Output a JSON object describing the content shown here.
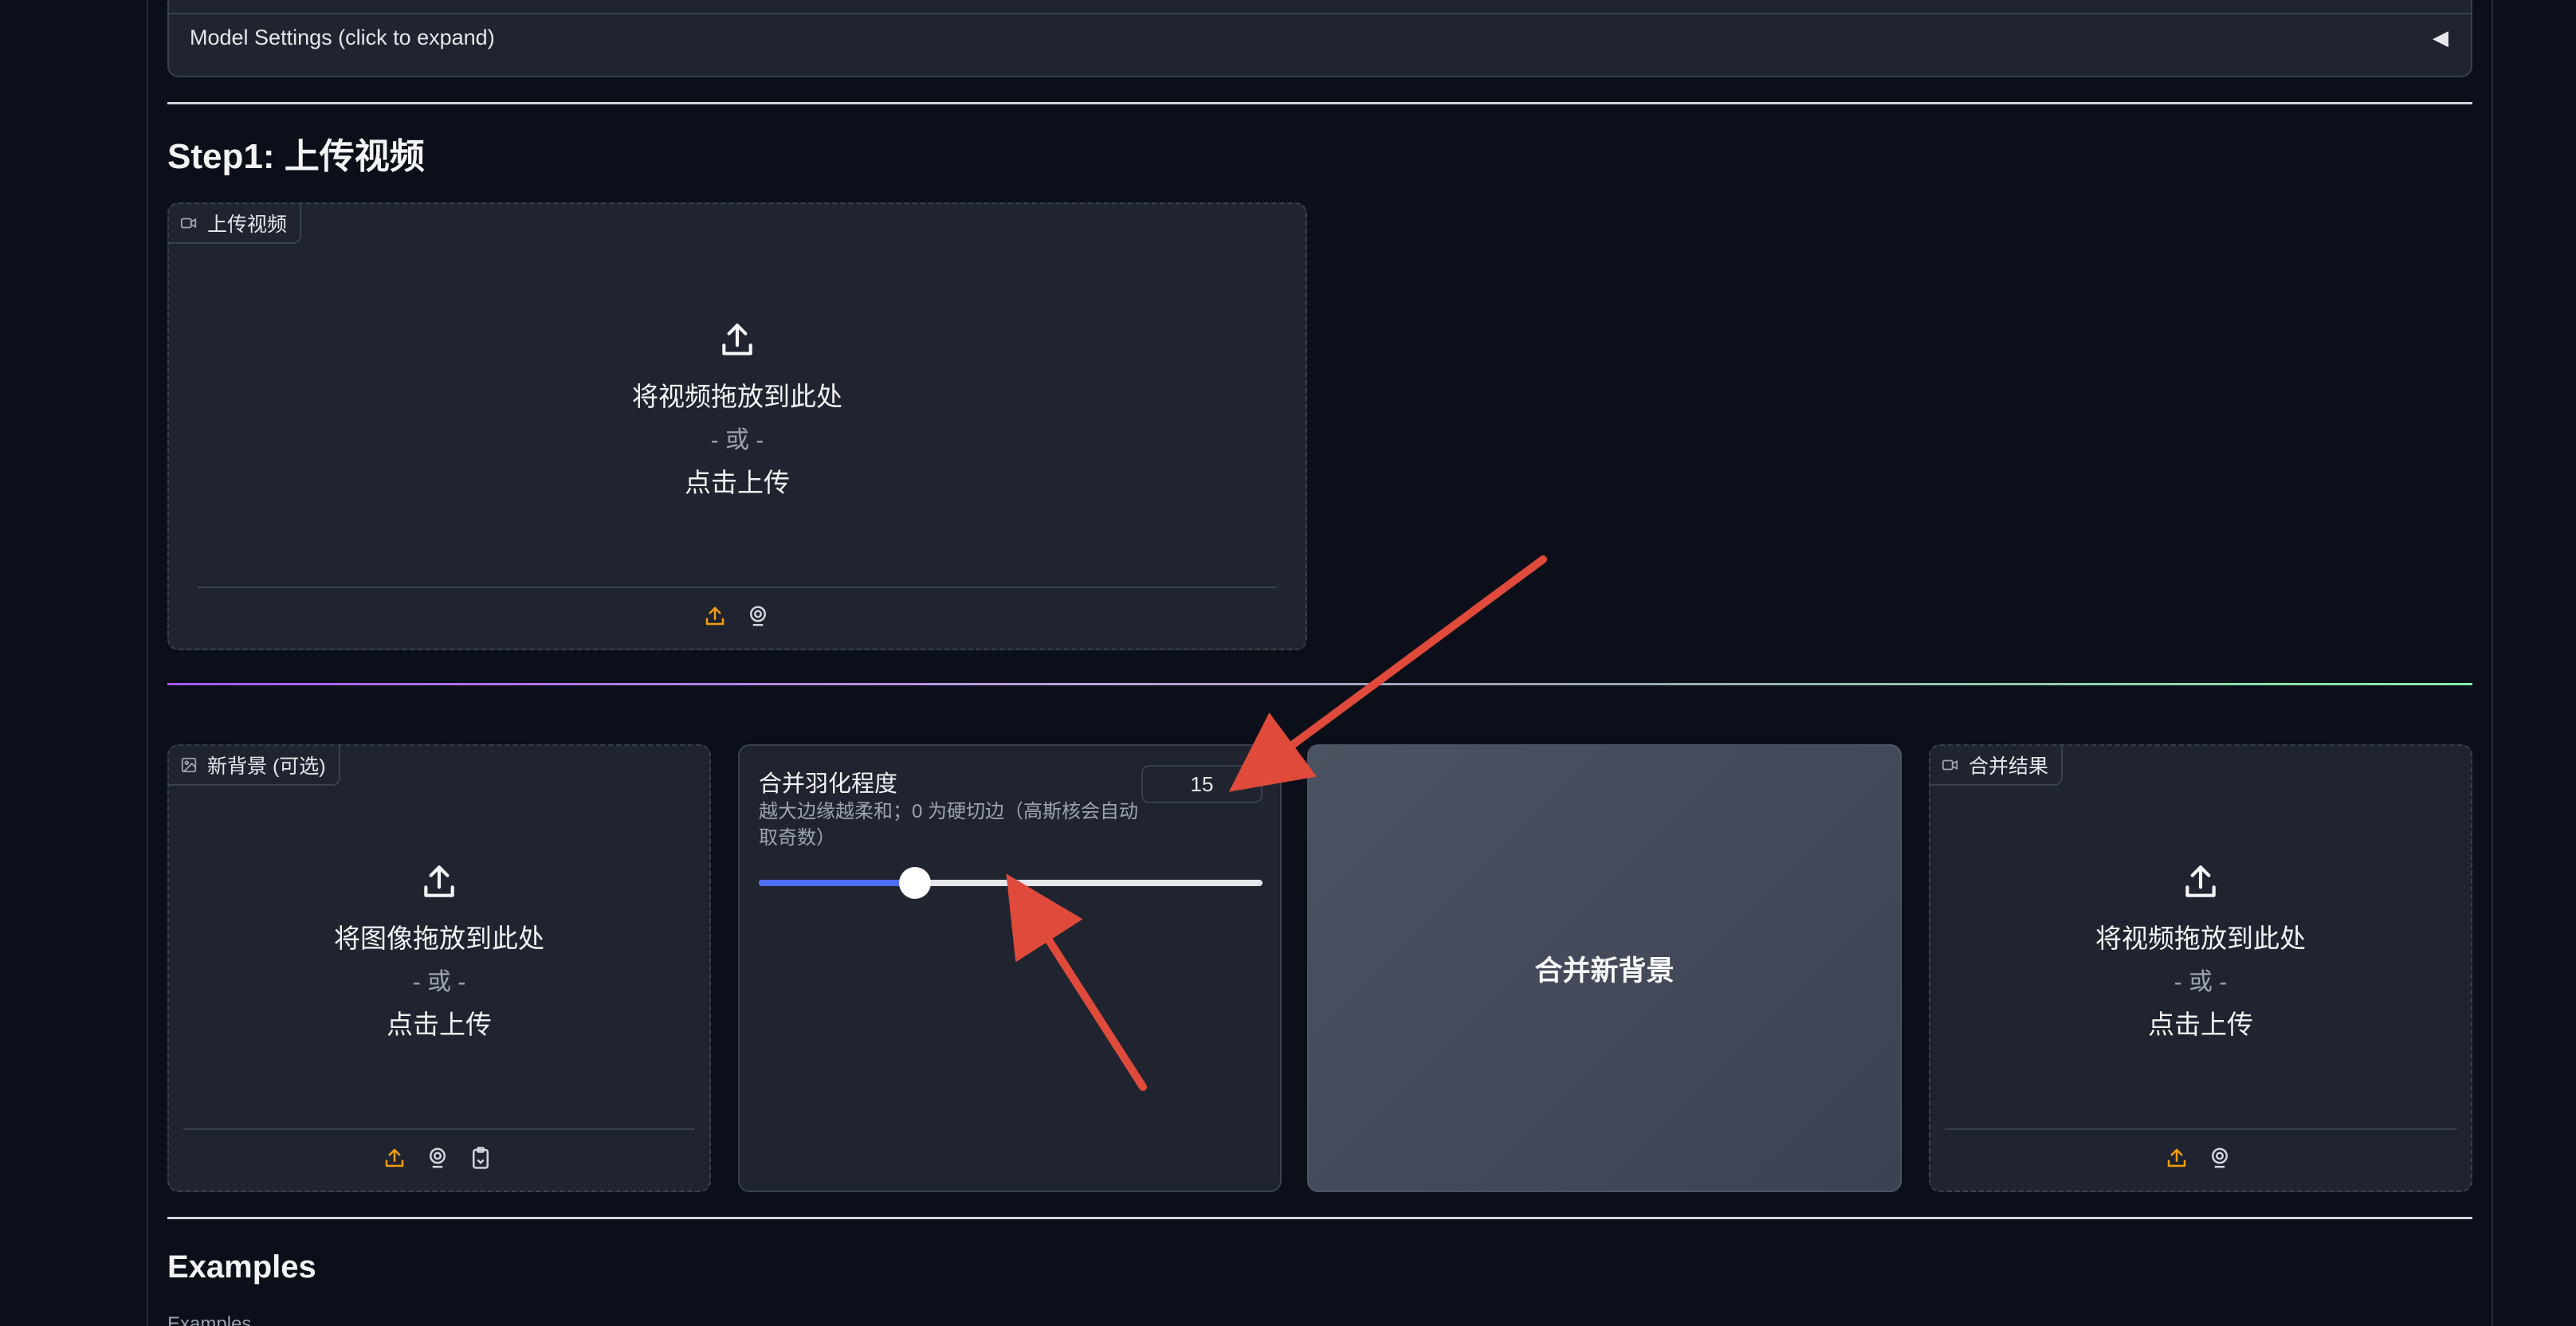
{
  "model_settings": {
    "label": "Model Settings (click to expand)",
    "caret": "◀"
  },
  "step1": {
    "title": "Step1: 上传视频",
    "upload_video": {
      "tag": "上传视频",
      "drop_text": "将视频拖放到此处",
      "or_text": "- 或 -",
      "click_text": "点击上传"
    }
  },
  "background": {
    "tag": "新背景 (可选)",
    "drop_text": "将图像拖放到此处",
    "or_text": "- 或 -",
    "click_text": "点击上传"
  },
  "feather": {
    "label": "合并羽化程度",
    "info": "越大边缘越柔和；0 为硬切边（高斯核会自动取奇数）",
    "value": "15",
    "fraction": 0.31
  },
  "merge_button": {
    "label": "合并新背景"
  },
  "result": {
    "tag": "合并结果",
    "drop_text": "将视频拖放到此处",
    "or_text": "- 或 -",
    "click_text": "点击上传"
  },
  "examples": {
    "title": "Examples",
    "sub": "Examples"
  },
  "colors": {
    "accent_orange": "#f59e0b",
    "slider_fill": "#4f6df5",
    "annotation_red": "#e04a3a"
  },
  "icons": [
    "video-icon",
    "image-icon",
    "upload-icon",
    "webcam-icon",
    "clipboard-icon"
  ]
}
